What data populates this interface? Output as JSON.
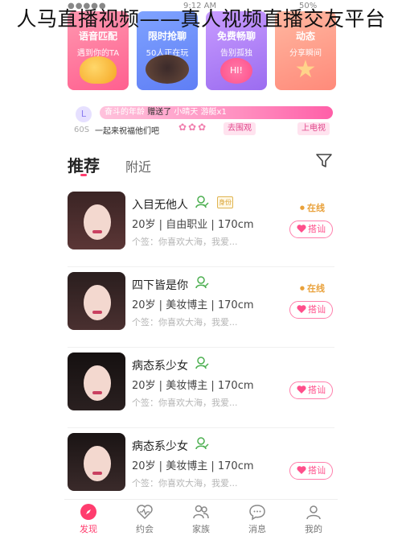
{
  "overlay_title": "人马直播视频——真人视频直播交友平台",
  "status_bar": {
    "carrier_dots": "●●●●●",
    "time": "9:12 AM",
    "battery": "50%"
  },
  "feature_cards": [
    {
      "title": "语音匹配",
      "subtitle": "遇到你的TA",
      "icon": "key-icon",
      "color": "#ff6f98"
    },
    {
      "title": "限时抢聊",
      "subtitle": "50人正在玩",
      "icon": "couple-photo",
      "color": "#6687f5"
    },
    {
      "title": "免费畅聊",
      "subtitle": "告别孤独",
      "icon": "hi-bubble-icon",
      "color": "#a777f3"
    },
    {
      "title": "动态",
      "subtitle": "分享瞬间",
      "icon": "star-icon",
      "color": "#ff9384"
    }
  ],
  "gift_banner": {
    "timer": "60S",
    "banner_prefix": "奋斗的年龄",
    "banner_action": "赠送了",
    "banner_target": "小晴天",
    "banner_suffix": "游艇x1",
    "line2": "一起来祝福他们吧",
    "go_label": "去围观",
    "tv_label": "上电视"
  },
  "tabs": {
    "recommend": "推荐",
    "nearby": "附近",
    "active_color": "#ff3d6e"
  },
  "users": [
    {
      "name": "入目无他人",
      "age": "20岁",
      "job": "自由职业",
      "height": "170cm",
      "signature": "个签：你喜欢大海，我爱...",
      "online": "在线",
      "chat": "搭讪",
      "id_badge": "身份"
    },
    {
      "name": "四下皆是你",
      "age": "20岁",
      "job": "美妆博主",
      "height": "170cm",
      "signature": "个签：你喜欢大海，我爱...",
      "online": "在线",
      "chat": "搭讪",
      "id_badge": ""
    },
    {
      "name": "病态系少女",
      "age": "20岁",
      "job": "美妆博主",
      "height": "170cm",
      "signature": "个签：你喜欢大海，我爱...",
      "online": "",
      "chat": "搭讪",
      "id_badge": ""
    },
    {
      "name": "病态系少女",
      "age": "20岁",
      "job": "美妆博主",
      "height": "170cm",
      "signature": "个签：你喜欢大海，我爱...",
      "online": "",
      "chat": "搭讪",
      "id_badge": ""
    }
  ],
  "nav": [
    {
      "label": "发现",
      "icon": "compass-icon",
      "active": true
    },
    {
      "label": "约会",
      "icon": "heart-pulse-icon",
      "active": false
    },
    {
      "label": "家族",
      "icon": "group-icon",
      "active": false
    },
    {
      "label": "消息",
      "icon": "message-icon",
      "active": false
    },
    {
      "label": "我的",
      "icon": "profile-icon",
      "active": false
    }
  ]
}
